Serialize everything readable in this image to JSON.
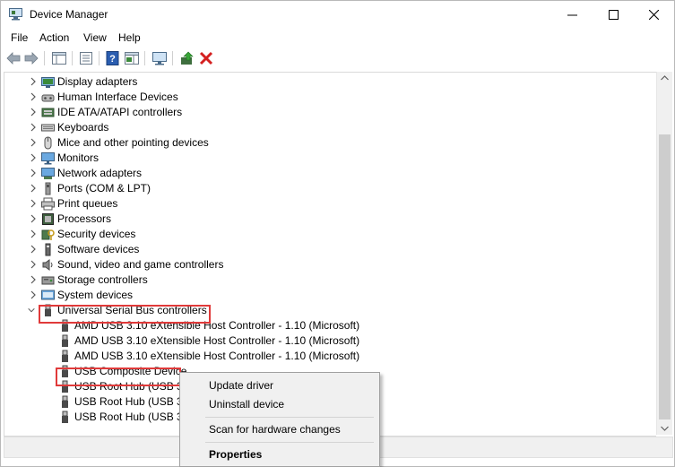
{
  "window": {
    "title": "Device Manager",
    "minimize_glyph": "—",
    "maximize_glyph": "☐",
    "close_glyph": "✕"
  },
  "menu": [
    "File",
    "Action",
    "View",
    "Help"
  ],
  "toolbar": {
    "icons": [
      "back-arrow-icon",
      "forward-arrow-icon",
      "show-hide-console-tree-icon",
      "properties-icon",
      "help-icon",
      "action-pane-icon",
      "scan-hardware-monitor-icon",
      "update-driver-icon",
      "uninstall-device-icon"
    ]
  },
  "tree": {
    "categories": [
      {
        "label": "Display adapters",
        "icon": "display-adapter-icon",
        "expanded": false
      },
      {
        "label": "Human Interface Devices",
        "icon": "hid-icon",
        "expanded": false
      },
      {
        "label": "IDE ATA/ATAPI controllers",
        "icon": "ide-controller-icon",
        "expanded": false
      },
      {
        "label": "Keyboards",
        "icon": "keyboard-icon",
        "expanded": false
      },
      {
        "label": "Mice and other pointing devices",
        "icon": "mouse-icon",
        "expanded": false
      },
      {
        "label": "Monitors",
        "icon": "monitor-icon",
        "expanded": false
      },
      {
        "label": "Network adapters",
        "icon": "network-adapter-icon",
        "expanded": false
      },
      {
        "label": "Ports (COM & LPT)",
        "icon": "port-icon",
        "expanded": false
      },
      {
        "label": "Print queues",
        "icon": "printer-icon",
        "expanded": false
      },
      {
        "label": "Processors",
        "icon": "processor-icon",
        "expanded": false
      },
      {
        "label": "Security devices",
        "icon": "security-device-icon",
        "expanded": false
      },
      {
        "label": "Software devices",
        "icon": "software-device-icon",
        "expanded": false
      },
      {
        "label": "Sound, video and game controllers",
        "icon": "speaker-icon",
        "expanded": false
      },
      {
        "label": "Storage controllers",
        "icon": "storage-controller-icon",
        "expanded": false
      },
      {
        "label": "System devices",
        "icon": "system-device-icon",
        "expanded": false
      },
      {
        "label": "Universal Serial Bus controllers",
        "icon": "usb-icon",
        "expanded": true
      }
    ],
    "usb_children": [
      "AMD USB 3.10 eXtensible Host Controller - 1.10 (Microsoft)",
      "AMD USB 3.10 eXtensible Host Controller - 1.10 (Microsoft)",
      "AMD USB 3.10 eXtensible Host Controller - 1.10 (Microsoft)",
      "USB Composite Device",
      "USB Root Hub (USB 3.0)",
      "USB Root Hub (USB 3.0)",
      "USB Root Hub (USB 3.0)"
    ]
  },
  "context_menu": {
    "update": "Update driver",
    "uninstall": "Uninstall device",
    "scan": "Scan for hardware changes",
    "properties": "Properties"
  },
  "colors": {
    "highlight_box": "#e03a3a",
    "error_red": "#d42020",
    "help_blue": "#2a5db0"
  }
}
